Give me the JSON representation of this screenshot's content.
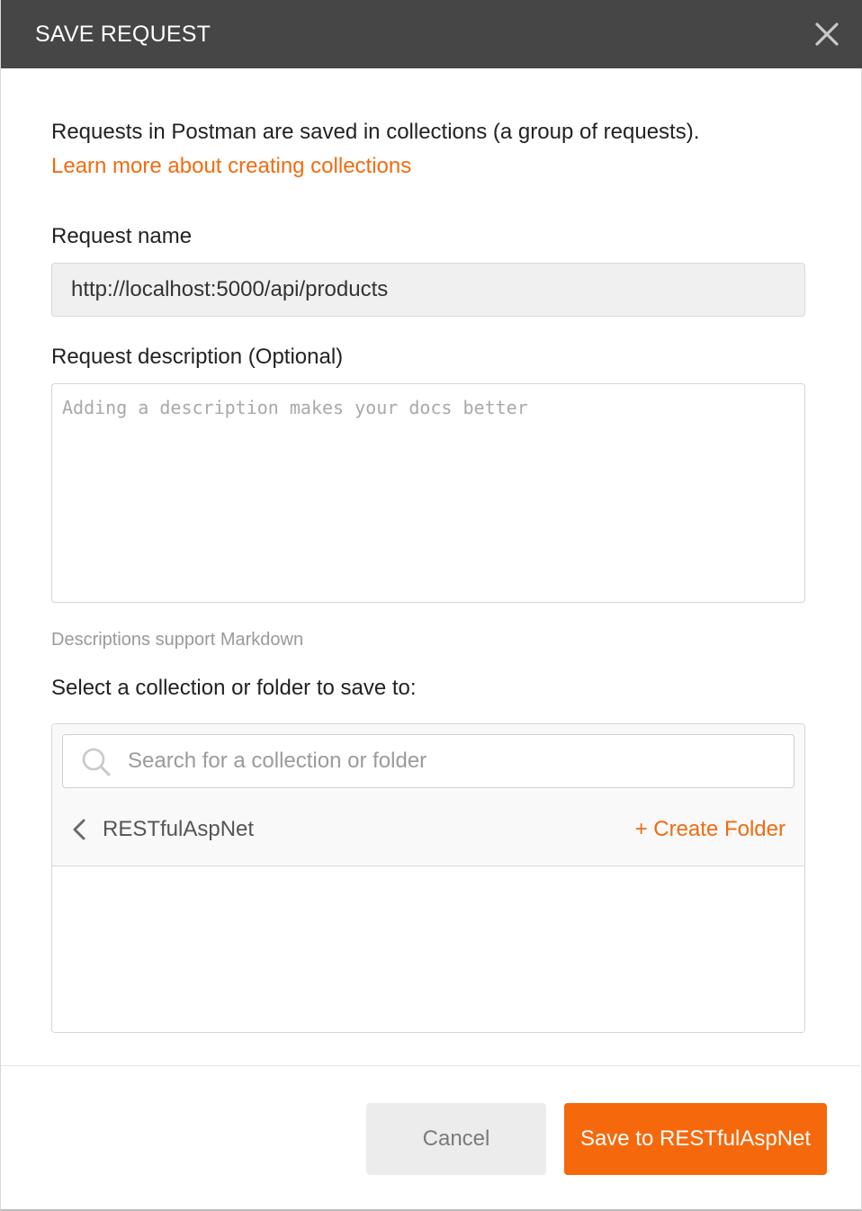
{
  "dialog": {
    "title": "SAVE REQUEST",
    "close_icon": "close-icon"
  },
  "intro": {
    "text": "Requests in Postman are saved in collections (a group of requests).",
    "link_text": "Learn more about creating collections"
  },
  "request_name": {
    "label": "Request name",
    "value": "http://localhost:5000/api/products"
  },
  "request_description": {
    "label": "Request description (Optional)",
    "value": "",
    "placeholder": "Adding a description makes your docs better",
    "hint": "Descriptions support Markdown"
  },
  "collection_picker": {
    "label": "Select a collection or folder to save to:",
    "search_placeholder": "Search for a collection or folder",
    "search_value": "",
    "current_collection": "RESTfulAspNet",
    "create_folder_label": "+ Create Folder",
    "folders": []
  },
  "footer": {
    "cancel_label": "Cancel",
    "save_label": "Save to RESTfulAspNet"
  },
  "colors": {
    "header_bg": "#464646",
    "accent": "#f26b0f",
    "save_button": "#f5690c"
  }
}
